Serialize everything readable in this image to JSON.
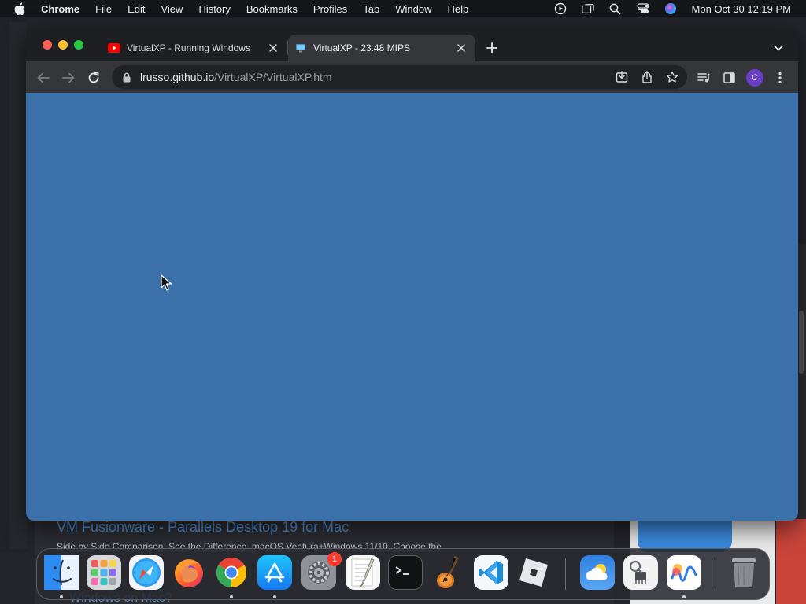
{
  "menubar": {
    "apple_icon": "apple-icon",
    "app_name": "Chrome",
    "items": [
      "File",
      "Edit",
      "View",
      "History",
      "Bookmarks",
      "Profiles",
      "Tab",
      "Window",
      "Help"
    ],
    "status_icons": [
      "screen-recording-icon",
      "stage-manager-icon",
      "spotlight-search-icon",
      "control-center-icon",
      "siri-icon"
    ],
    "clock": "Mon Oct 30  12:19 PM"
  },
  "browser": {
    "tabs": [
      {
        "title": "VirtualXP - Running Windows",
        "favicon": "youtube-icon",
        "active": false
      },
      {
        "title": "VirtualXP - 23.48 MIPS",
        "favicon": "monitor-favicon-icon",
        "active": true
      }
    ],
    "new_tab_icon": "plus-icon",
    "tab_search_icon": "chevron-down-icon",
    "toolbar": {
      "back_icon": "back-arrow-icon",
      "forward_icon": "forward-arrow-icon",
      "reload_icon": "reload-icon",
      "url_host": "lrusso.github.io",
      "url_path": "/VirtualXP/VirtualXP.htm",
      "omnibox_icons": [
        "install-app-icon",
        "share-icon",
        "bookmark-star-icon"
      ],
      "right_icons": [
        "media-controls-icon",
        "side-panel-icon",
        "kebab-menu-icon"
      ],
      "profile_initial": "C"
    },
    "viewport_color": "#3c70a9"
  },
  "background_page": {
    "heading": "VM Fusionware - Parallels Desktop 19 for Mac",
    "subtext": "Side by Side Comparison. See the Difference. macOS Ventura+Windows 11/10. Choose the",
    "link": "Windows on Mac?"
  },
  "dock": {
    "apps": [
      {
        "name": "Finder",
        "running": true
      },
      {
        "name": "Launchpad",
        "running": false
      },
      {
        "name": "Safari",
        "running": false
      },
      {
        "name": "Firefox",
        "running": false
      },
      {
        "name": "Google Chrome",
        "running": true
      },
      {
        "name": "App Store",
        "running": true
      },
      {
        "name": "System Settings",
        "running": false,
        "badge": "1"
      },
      {
        "name": "TextEdit",
        "running": false
      },
      {
        "name": "Terminal",
        "running": false
      },
      {
        "name": "GarageBand",
        "running": false
      },
      {
        "name": "Visual Studio Code",
        "running": false
      },
      {
        "name": "Roblox",
        "running": false
      },
      {
        "name": "Weather",
        "running": false
      },
      {
        "name": "System Information",
        "running": false
      },
      {
        "name": "Freeform",
        "running": true
      },
      {
        "name": "Trash",
        "running": false
      }
    ]
  }
}
